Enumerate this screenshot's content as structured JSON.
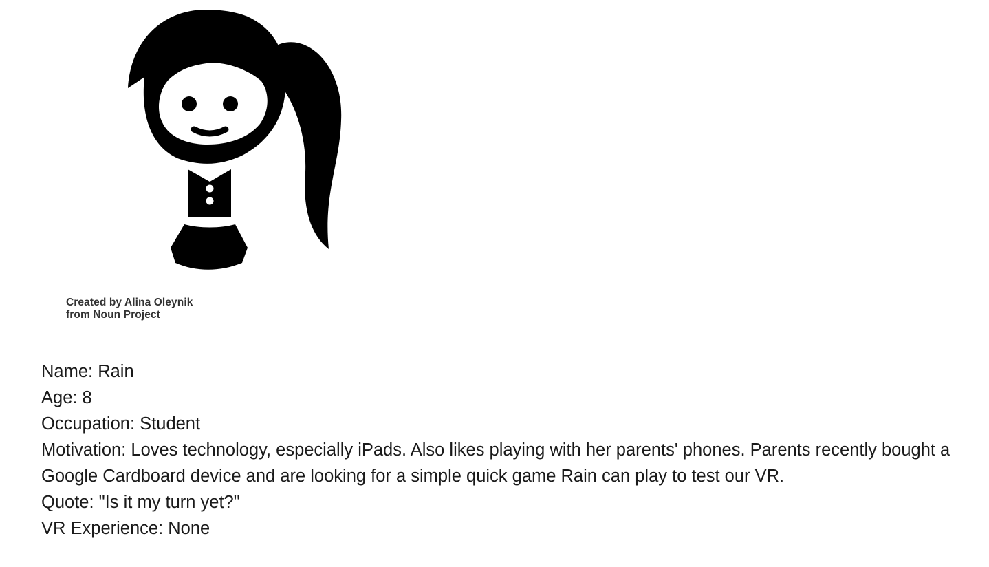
{
  "illustration": {
    "icon": "girl-with-ponytail-icon",
    "credit_line1": "Created by Alina Oleynik",
    "credit_line2": "from Noun Project"
  },
  "persona": {
    "name": "Name: Rain",
    "age": "Age: 8",
    "occupation": "Occupation: Student",
    "motivation": "Motivation: Loves technology, especially iPads. Also likes playing with her parents' phones. Parents recently bought a Google Cardboard device and are looking for a simple quick game Rain can play to test our VR.",
    "quote": "Quote: \"Is it my turn yet?\"",
    "vr_experience": "VR Experience: None"
  }
}
